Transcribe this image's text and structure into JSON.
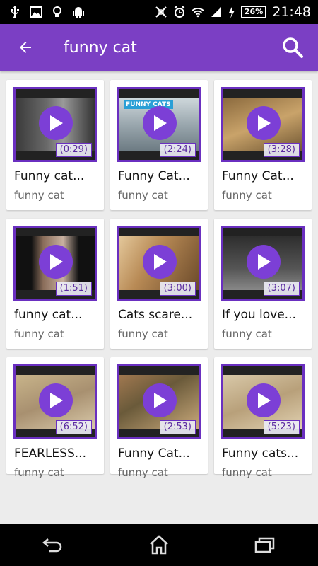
{
  "status_bar": {
    "time": "21:48",
    "battery": "26%",
    "icons": [
      "usb-icon",
      "image-icon",
      "lightbulb-icon",
      "android-icon",
      "mute-icon",
      "alarm-icon",
      "wifi-icon",
      "signal-icon",
      "charging-icon"
    ]
  },
  "app_bar": {
    "title": "funny cat",
    "color": "#7b3fc4"
  },
  "videos": [
    {
      "title": "Funny cat...",
      "subtitle": "funny cat",
      "duration": "(0:29)"
    },
    {
      "title": "Funny Cat...",
      "subtitle": "funny cat",
      "duration": "(2:24)",
      "thumb_text": "FUNNY CATS"
    },
    {
      "title": "Funny Cat...",
      "subtitle": "funny cat",
      "duration": "(3:28)"
    },
    {
      "title": "funny cat...",
      "subtitle": "funny cat",
      "duration": "(1:51)"
    },
    {
      "title": "Cats scare...",
      "subtitle": "funny cat",
      "duration": "(3:00)"
    },
    {
      "title": "If you love...",
      "subtitle": "funny cat",
      "duration": "(3:07)"
    },
    {
      "title": "FEARLESS...",
      "subtitle": "funny cat",
      "duration": "(6:52)"
    },
    {
      "title": "Funny Cat...",
      "subtitle": "funny cat",
      "duration": "(2:53)"
    },
    {
      "title": "Funny cats...",
      "subtitle": "funny cat",
      "duration": "(5:23)"
    }
  ],
  "nav_bar": {
    "buttons": [
      "back-nav-icon",
      "home-icon",
      "recent-apps-icon"
    ]
  }
}
